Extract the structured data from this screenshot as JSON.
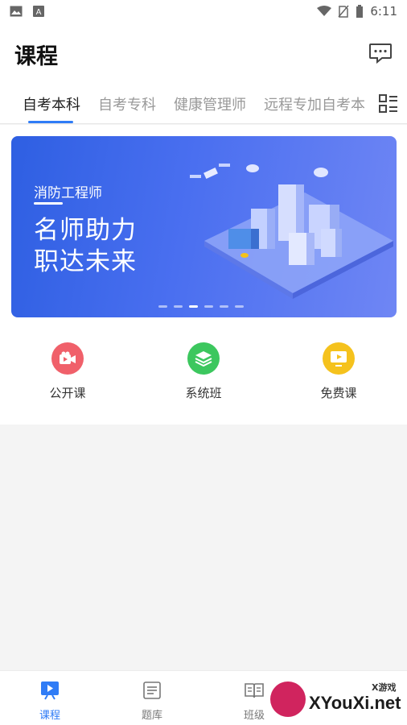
{
  "status_bar": {
    "time": "6:11"
  },
  "header": {
    "title": "课程",
    "message_icon": "chat-bubble-icon"
  },
  "tabs": [
    {
      "label": "自考本科",
      "active": true
    },
    {
      "label": "自考专科",
      "active": false
    },
    {
      "label": "健康管理师",
      "active": false
    },
    {
      "label": "远程专加自考本",
      "active": false
    }
  ],
  "banner": {
    "subtitle": "消防工程师",
    "title_line1": "名师助力",
    "title_line2": "职达未来",
    "slide_count": 6,
    "active_slide": 2
  },
  "quick_links": [
    {
      "label": "公开课",
      "icon": "video-camera-icon",
      "color": "#f0606a"
    },
    {
      "label": "系统班",
      "icon": "layers-icon",
      "color": "#3cc75e"
    },
    {
      "label": "免费课",
      "icon": "play-screen-icon",
      "color": "#f5c21d"
    }
  ],
  "bottom_nav": [
    {
      "label": "课程",
      "icon": "play-board-icon",
      "active": true
    },
    {
      "label": "题库",
      "icon": "question-bank-icon",
      "active": false
    },
    {
      "label": "班级",
      "icon": "open-book-icon",
      "active": false
    }
  ],
  "watermark": {
    "text": "XYouXi.net",
    "small": "X游戏"
  },
  "colors": {
    "accent": "#2f7cf6"
  }
}
